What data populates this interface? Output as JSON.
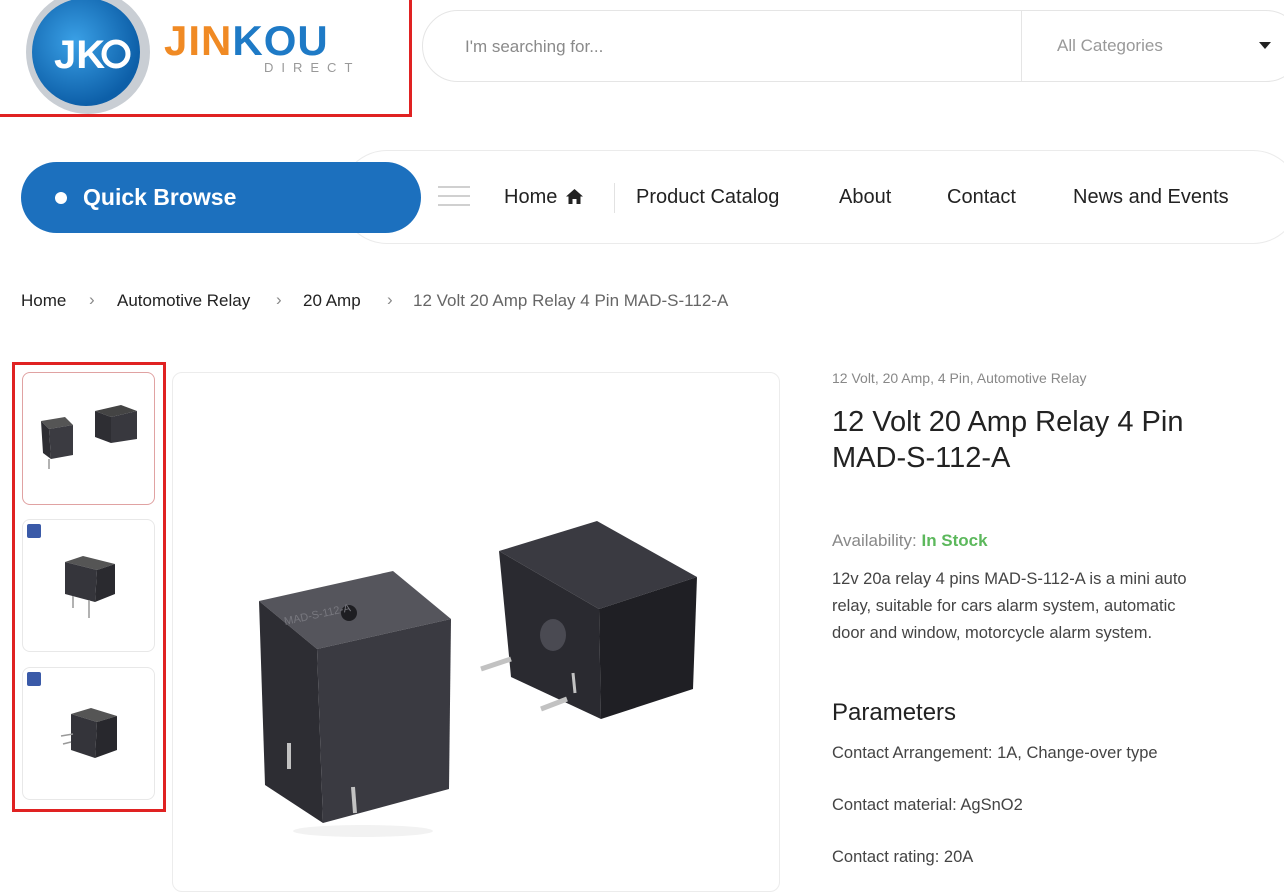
{
  "logo": {
    "word_1": "JIN",
    "word_2": "KOU",
    "sub": "DIRECT"
  },
  "search": {
    "placeholder": "I'm searching for...",
    "category": "All Categories"
  },
  "nav": {
    "quick_browse": "Quick Browse",
    "items": [
      "Home",
      "Product Catalog",
      "About",
      "Contact",
      "News and Events"
    ]
  },
  "breadcrumb": [
    "Home",
    "Automotive Relay",
    "20 Amp",
    "12 Volt 20 Amp Relay 4 Pin MAD-S-112-A"
  ],
  "product": {
    "tags": "12 Volt, 20 Amp, 4 Pin, Automotive Relay",
    "title": "12 Volt 20 Amp Relay 4 Pin MAD-S-112-A",
    "availability_label": "Availability:",
    "availability_value": "In Stock",
    "description": "12v 20a relay 4 pins MAD-S-112-A is a mini auto relay, suitable for cars alarm system, automatic door and window, motorcycle alarm system.",
    "parameters_heading": "Parameters",
    "parameters": [
      "Contact Arrangement: 1A, Change-over type",
      "Contact material: AgSnO2",
      "Contact rating: 20A"
    ],
    "relay_print": "MAD-S-112-A"
  },
  "colors": {
    "brand_blue": "#1c70be",
    "brand_orange": "#f08a24",
    "in_stock_green": "#5cb85c",
    "highlight_red": "#e02222"
  }
}
